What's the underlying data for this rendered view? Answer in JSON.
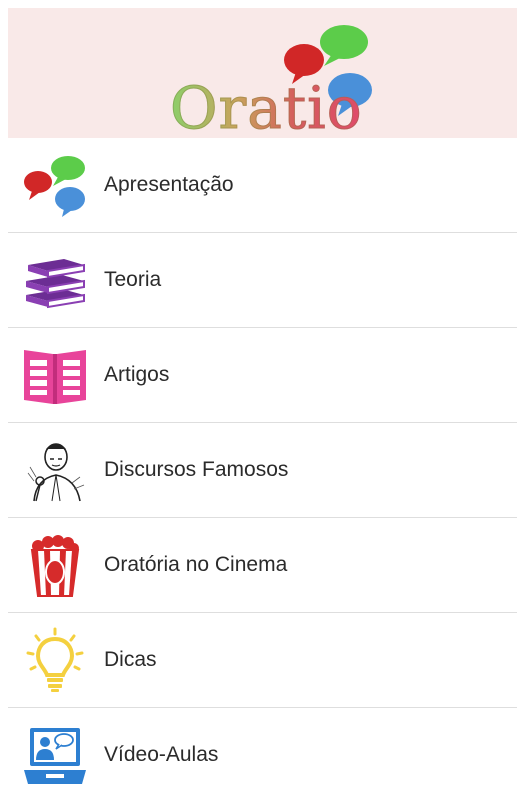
{
  "header": {
    "logo_text": "Oratio",
    "logo_icon": "speech-bubbles-icon"
  },
  "colors": {
    "header_bg": "#f9e9e8",
    "bubble_red": "#d12727",
    "bubble_green": "#5ccc4a",
    "bubble_blue": "#4a90d9",
    "books_purple": "#8a3fb3",
    "book_pink": "#e8449a",
    "popcorn_red": "#d62b2b",
    "bulb_yellow": "#f4d03f",
    "screen_blue": "#2d7fd1"
  },
  "menu": {
    "items": [
      {
        "label": "Apresentação",
        "icon": "speech-bubbles-icon"
      },
      {
        "label": "Teoria",
        "icon": "books-icon"
      },
      {
        "label": "Artigos",
        "icon": "open-book-icon"
      },
      {
        "label": "Discursos Famosos",
        "icon": "speaker-portrait-icon"
      },
      {
        "label": "Oratória no Cinema",
        "icon": "popcorn-icon"
      },
      {
        "label": "Dicas",
        "icon": "lightbulb-icon"
      },
      {
        "label": "Vídeo-Aulas",
        "icon": "video-lesson-icon"
      }
    ]
  }
}
